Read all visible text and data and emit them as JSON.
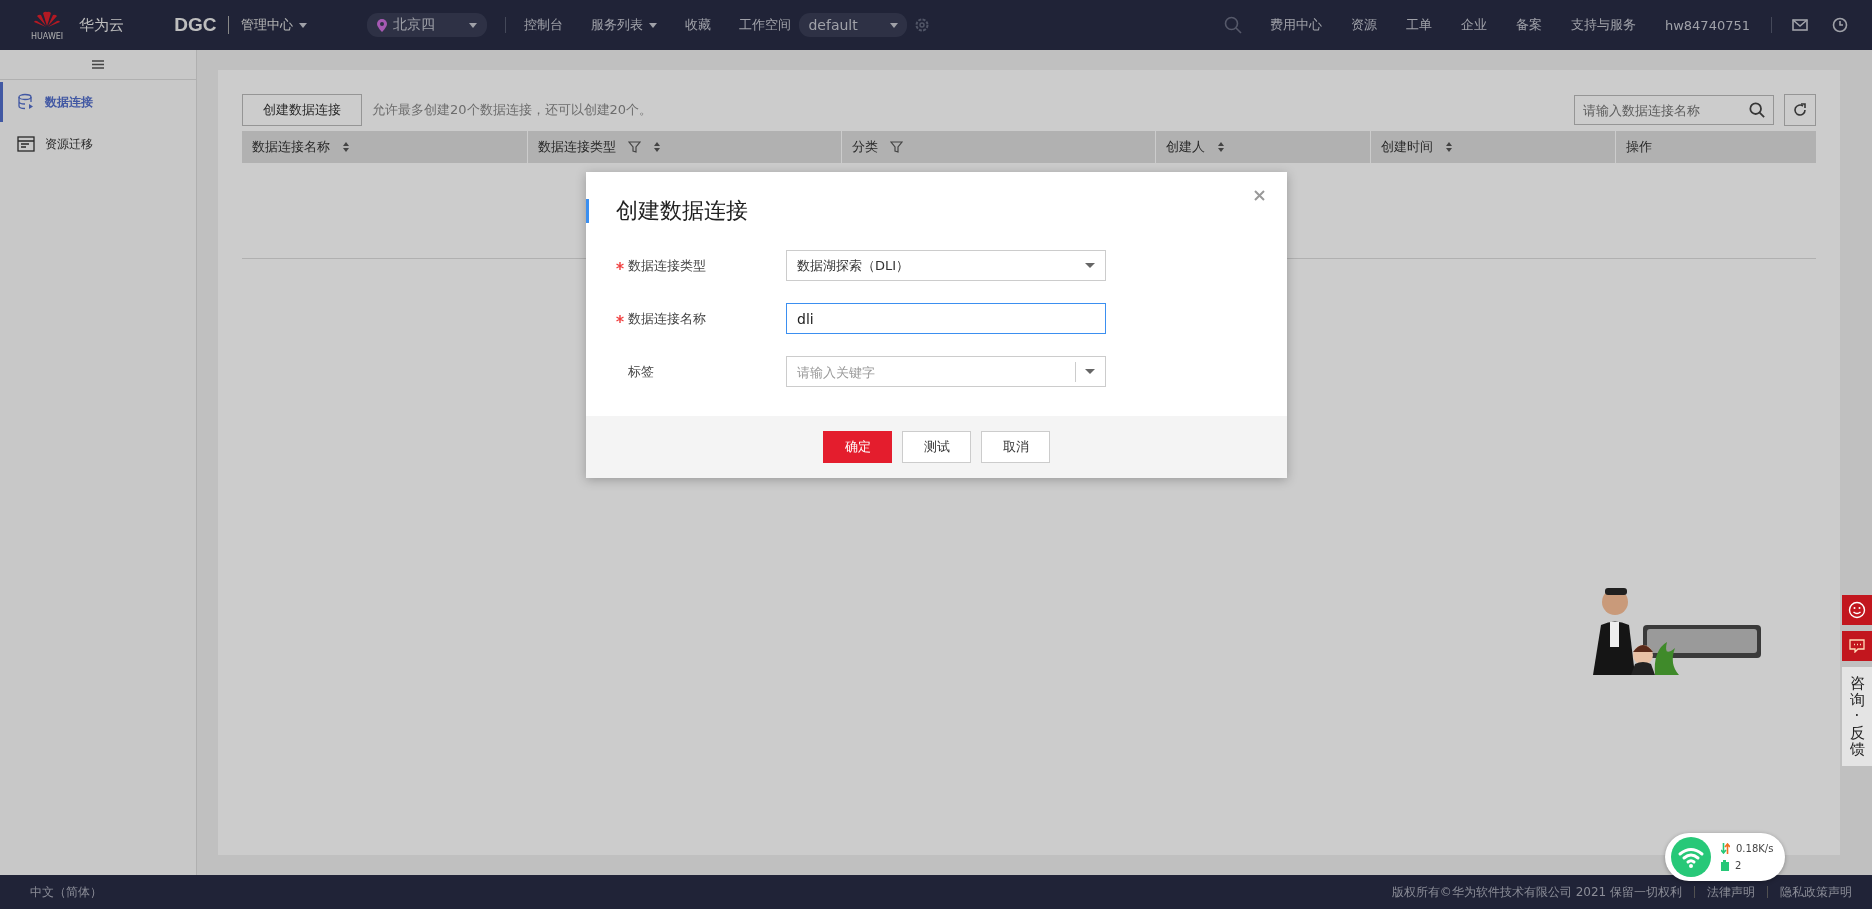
{
  "topbar": {
    "brand": "华为云",
    "brand_caption": "HUAWEI",
    "product": "DGC",
    "console": "管理中心",
    "region": "北京四",
    "nav": [
      {
        "label": "控制台",
        "dropdown": false
      },
      {
        "label": "服务列表",
        "dropdown": true
      },
      {
        "label": "收藏",
        "dropdown": false
      },
      {
        "label": "工作空间",
        "dropdown": false
      }
    ],
    "workspace": "default",
    "right": [
      "费用中心",
      "资源",
      "工单",
      "企业",
      "备案",
      "支持与服务"
    ],
    "user": "hw84740751"
  },
  "sidebar": {
    "items": [
      {
        "label": "数据连接",
        "selected": true
      },
      {
        "label": "资源迁移",
        "selected": false
      }
    ]
  },
  "toolbar": {
    "create_button": "创建数据连接",
    "hint": "允许最多创建20个数据连接，还可以创建20个。",
    "search": {
      "placeholder": "请输入数据连接名称"
    }
  },
  "table": {
    "columns": [
      {
        "label": "数据连接名称",
        "sortable": true,
        "filterable": false
      },
      {
        "label": "数据连接类型",
        "sortable": true,
        "filterable": true
      },
      {
        "label": "分类",
        "sortable": false,
        "filterable": true
      },
      {
        "label": "创建人",
        "sortable": true,
        "filterable": false
      },
      {
        "label": "创建时间",
        "sortable": true,
        "filterable": false
      },
      {
        "label": "操作",
        "sortable": false,
        "filterable": false
      }
    ]
  },
  "modal": {
    "title": "创建数据连接",
    "fields": [
      {
        "kind": "select",
        "label": "数据连接类型",
        "required": true,
        "value": "数据湖探索（DLI）",
        "focused": false
      },
      {
        "kind": "input",
        "label": "数据连接名称",
        "required": true,
        "value": "dli",
        "focused": true
      },
      {
        "kind": "tags",
        "label": "标签",
        "required": false,
        "placeholder": "请输入关键字",
        "focused": false
      }
    ],
    "buttons": [
      {
        "label": "确定",
        "kind": "primary"
      },
      {
        "label": "测试",
        "kind": "default"
      },
      {
        "label": "取消",
        "kind": "default"
      }
    ]
  },
  "side_tools": {
    "consult": "咨询·反馈"
  },
  "net_widget": {
    "speed": "0.18K/s",
    "count": "2"
  },
  "footer": {
    "language": "中文（简体）",
    "copyright": "版权所有©华为软件技术有限公司 2021 保留一切权利",
    "links": [
      "法律声明",
      "隐私政策声明"
    ]
  }
}
